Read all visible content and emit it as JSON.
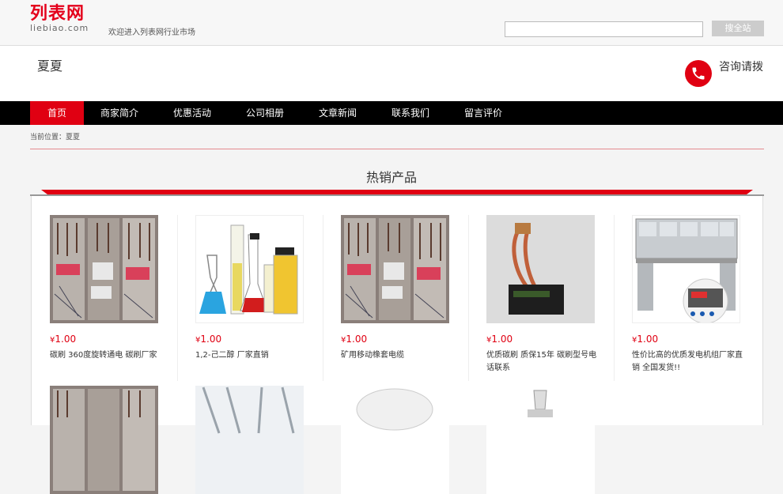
{
  "header": {
    "logo_cn": "列表网",
    "logo_en": "liebiao.com",
    "welcome": "欢迎进入列表网行业市场",
    "search_placeholder": "",
    "search_button": "搜全站"
  },
  "shop": {
    "name": "夏夏",
    "contact_label": "咨询请拨"
  },
  "nav": {
    "items": [
      {
        "label": "首页",
        "active": true
      },
      {
        "label": "商家简介"
      },
      {
        "label": "优惠活动"
      },
      {
        "label": "公司相册"
      },
      {
        "label": "文章新闻"
      },
      {
        "label": "联系我们"
      },
      {
        "label": "留言评价"
      }
    ]
  },
  "breadcrumb": "当前位置：夏夏",
  "section": {
    "title": "热销产品"
  },
  "products": [
    {
      "currency": "¥",
      "price": "1.00",
      "name": "碳刷 360度旋转通电 碳刷厂家",
      "image": "electrical-cabinet"
    },
    {
      "currency": "¥",
      "price": "1.00",
      "name": "1,2-己二醇 厂家直销",
      "image": "lab-glassware"
    },
    {
      "currency": "¥",
      "price": "1.00",
      "name": "矿用移动橡套电缆",
      "image": "electrical-cabinet"
    },
    {
      "currency": "¥",
      "price": "1.00",
      "name": "优质碳刷 质保15年 碳刷型号电话联系",
      "image": "carbon-brush"
    },
    {
      "currency": "¥",
      "price": "1.00",
      "name": "性价比高的优质发电机组厂家直销 全国发货!!",
      "image": "test-bench"
    }
  ],
  "colors": {
    "brand_red": "#e00012",
    "nav_bg": "#000000"
  }
}
